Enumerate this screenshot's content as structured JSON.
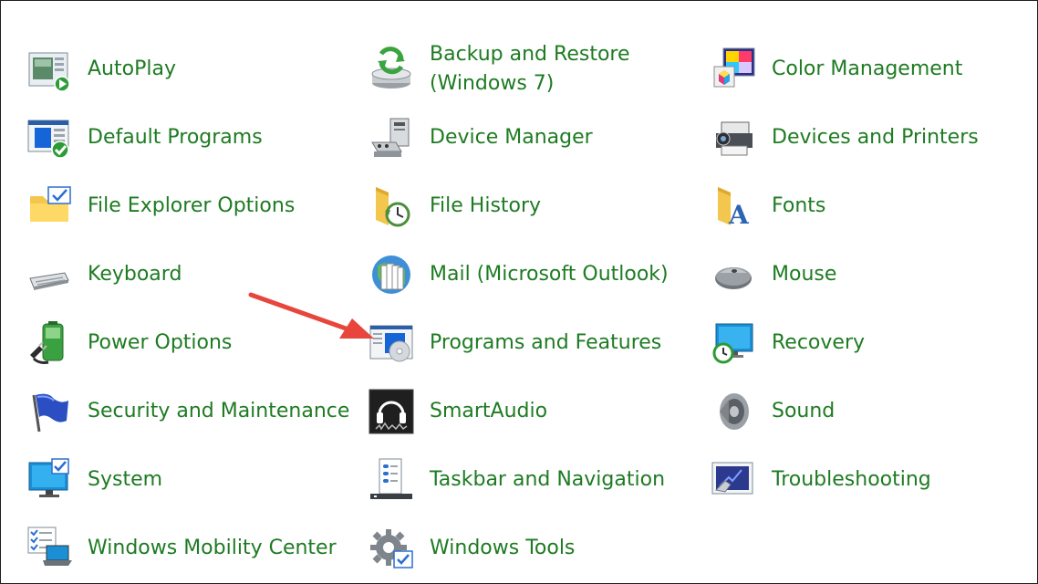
{
  "items": [
    {
      "label": "AutoPlay",
      "icon": "autoplay-icon"
    },
    {
      "label": "Backup and Restore",
      "label2": "(Windows 7)",
      "icon": "backup-restore-icon"
    },
    {
      "label": "Color Management",
      "icon": "color-management-icon"
    },
    {
      "label": "Default Programs",
      "icon": "default-programs-icon"
    },
    {
      "label": "Device Manager",
      "icon": "device-manager-icon"
    },
    {
      "label": "Devices and Printers",
      "icon": "devices-printers-icon"
    },
    {
      "label": "File Explorer Options",
      "icon": "file-explorer-options-icon"
    },
    {
      "label": "File History",
      "icon": "file-history-icon"
    },
    {
      "label": "Fonts",
      "icon": "fonts-icon"
    },
    {
      "label": "Keyboard",
      "icon": "keyboard-icon"
    },
    {
      "label": "Mail (Microsoft Outlook)",
      "icon": "mail-icon"
    },
    {
      "label": "Mouse",
      "icon": "mouse-icon"
    },
    {
      "label": "Power Options",
      "icon": "power-options-icon"
    },
    {
      "label": "Programs and Features",
      "icon": "programs-features-icon"
    },
    {
      "label": "Recovery",
      "icon": "recovery-icon"
    },
    {
      "label": "Security and Maintenance",
      "icon": "security-maintenance-icon"
    },
    {
      "label": "SmartAudio",
      "icon": "smartaudio-icon"
    },
    {
      "label": "Sound",
      "icon": "sound-icon"
    },
    {
      "label": "System",
      "icon": "system-icon"
    },
    {
      "label": "Taskbar and Navigation",
      "icon": "taskbar-navigation-icon"
    },
    {
      "label": "Troubleshooting",
      "icon": "troubleshooting-icon"
    },
    {
      "label": "Windows Mobility Center",
      "icon": "windows-mobility-center-icon"
    },
    {
      "label": "Windows Tools",
      "icon": "windows-tools-icon"
    }
  ],
  "colors": {
    "link": "#1e7b22",
    "annotation_arrow": "#e8453c"
  },
  "annotation": {
    "icon": "red-arrow-icon",
    "target": "Programs and Features"
  }
}
